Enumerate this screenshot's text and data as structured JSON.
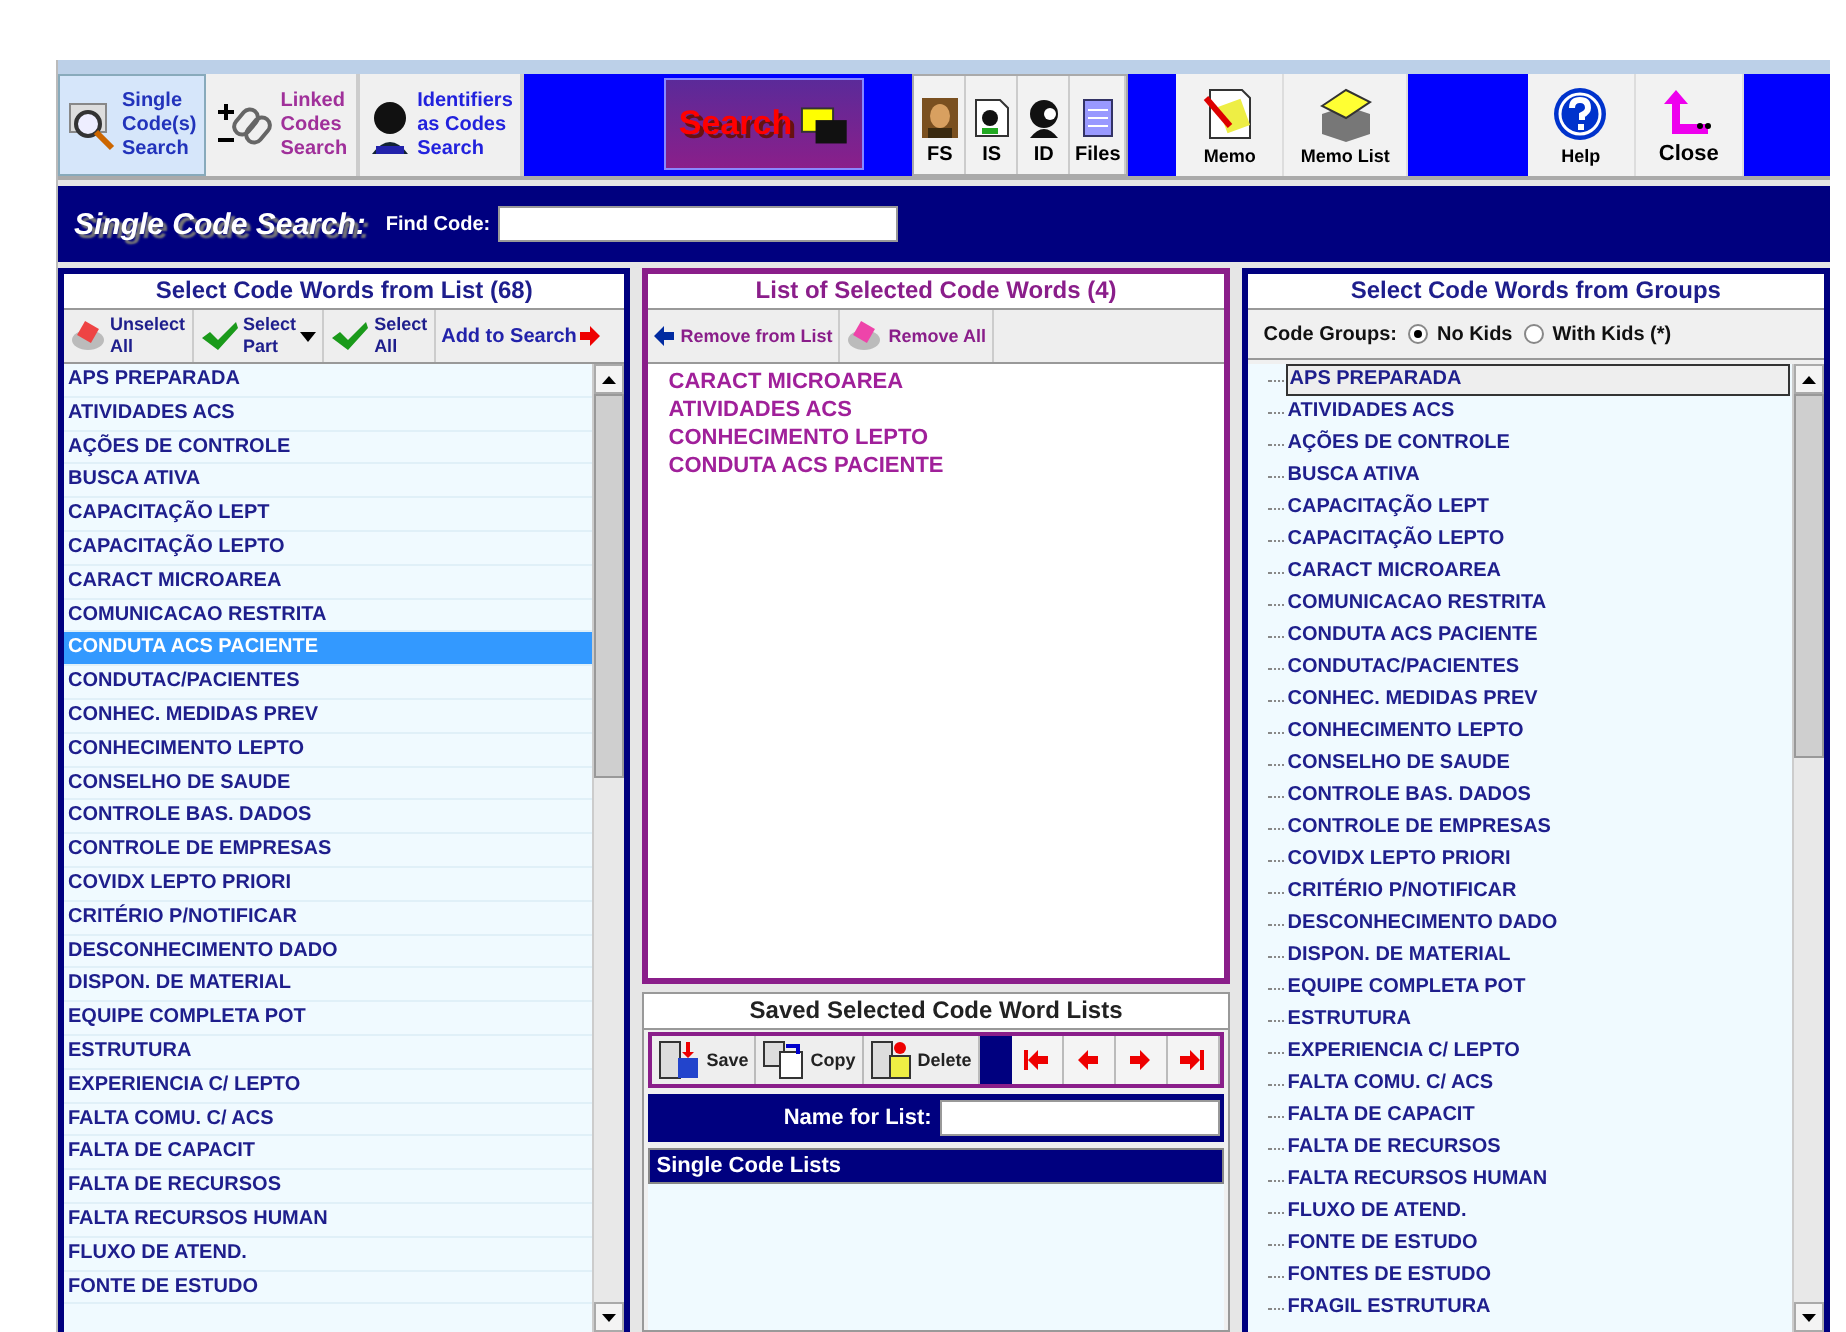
{
  "toolbar": {
    "mode_tabs": [
      {
        "kind": "single",
        "label_lines": [
          "Single",
          "Code(s)",
          "Search"
        ],
        "selected": true
      },
      {
        "kind": "linked",
        "label_lines": [
          "Linked",
          "Codes",
          "Search"
        ],
        "selected": false
      },
      {
        "kind": "identifiers",
        "label_lines": [
          "Identifiers",
          "as Codes",
          "Search"
        ],
        "selected": false
      }
    ],
    "search_button": {
      "label": "Search"
    },
    "small_buttons": [
      {
        "kind": "fs",
        "label": "FS"
      },
      {
        "kind": "is",
        "label": "IS"
      },
      {
        "kind": "id",
        "label": "ID"
      },
      {
        "kind": "files",
        "label": "Files"
      }
    ],
    "memo_buttons": [
      {
        "kind": "memo",
        "label": "Memo"
      },
      {
        "kind": "memo_list",
        "label": "Memo List"
      }
    ],
    "end_buttons": [
      {
        "kind": "help",
        "label": "Help"
      },
      {
        "kind": "close",
        "label": "Close"
      }
    ]
  },
  "search_header": {
    "title": "Single Code Search:",
    "find_label": "Find Code:"
  },
  "left_panel": {
    "title": "Select Code Words from List (68)",
    "tools": [
      {
        "kind": "unselect",
        "label_lines": [
          "Unselect",
          "All"
        ]
      },
      {
        "kind": "select_part",
        "label_lines": [
          "Select",
          "Part"
        ]
      },
      {
        "kind": "select_all",
        "label_lines": [
          "Select",
          "All"
        ]
      },
      {
        "kind": "add",
        "label_lines": [
          "Add to Search"
        ]
      }
    ],
    "items": [
      {
        "label": "APS PREPARADA",
        "selected": false
      },
      {
        "label": "ATIVIDADES ACS",
        "selected": false
      },
      {
        "label": "AÇÕES DE CONTROLE",
        "selected": false
      },
      {
        "label": "BUSCA ATIVA",
        "selected": false
      },
      {
        "label": "CAPACITAÇÃO LEPT",
        "selected": false
      },
      {
        "label": "CAPACITAÇÃO LEPTO",
        "selected": false
      },
      {
        "label": "CARACT MICROAREA",
        "selected": false
      },
      {
        "label": "COMUNICACAO RESTRITA",
        "selected": false
      },
      {
        "label": "CONDUTA ACS PACIENTE",
        "selected": true
      },
      {
        "label": "CONDUTAC/PACIENTES",
        "selected": false
      },
      {
        "label": "CONHEC. MEDIDAS PREV",
        "selected": false
      },
      {
        "label": "CONHECIMENTO LEPTO",
        "selected": false
      },
      {
        "label": "CONSELHO DE SAUDE",
        "selected": false
      },
      {
        "label": "CONTROLE BAS. DADOS",
        "selected": false
      },
      {
        "label": "CONTROLE DE EMPRESAS",
        "selected": false
      },
      {
        "label": "COVIDX LEPTO PRIORI",
        "selected": false
      },
      {
        "label": "CRITÉRIO P/NOTIFICAR",
        "selected": false
      },
      {
        "label": "DESCONHECIMENTO DADO",
        "selected": false
      },
      {
        "label": "DISPON. DE MATERIAL",
        "selected": false
      },
      {
        "label": "EQUIPE COMPLETA POT",
        "selected": false
      },
      {
        "label": "ESTRUTURA",
        "selected": false
      },
      {
        "label": "EXPERIENCIA C/ LEPTO",
        "selected": false
      },
      {
        "label": "FALTA COMU. C/ ACS",
        "selected": false
      },
      {
        "label": "FALTA DE CAPACIT",
        "selected": false
      },
      {
        "label": "FALTA DE RECURSOS",
        "selected": false
      },
      {
        "label": "FALTA RECURSOS HUMAN",
        "selected": false
      },
      {
        "label": "FLUXO DE ATEND.",
        "selected": false
      },
      {
        "label": "FONTE DE ESTUDO",
        "selected": false
      }
    ]
  },
  "middle_panel": {
    "title": "List of Selected Code Words (4)",
    "tools": [
      {
        "kind": "remove",
        "label": "Remove from List"
      },
      {
        "kind": "remove_all",
        "label": "Remove All"
      }
    ],
    "items": [
      "CARACT MICROAREA",
      "ATIVIDADES ACS",
      "CONHECIMENTO LEPTO",
      "CONDUTA ACS PACIENTE"
    ]
  },
  "saved_panel": {
    "title": "Saved Selected Code Word Lists",
    "tools": [
      {
        "kind": "save",
        "label": "Save"
      },
      {
        "kind": "copy",
        "label": "Copy"
      },
      {
        "kind": "delete",
        "label": "Delete"
      }
    ],
    "nav": [
      {
        "kind": "first"
      },
      {
        "kind": "prev"
      },
      {
        "kind": "next"
      },
      {
        "kind": "last"
      }
    ],
    "name_label": "Name for List:",
    "list_header": "Single Code Lists"
  },
  "right_panel": {
    "title": "Select Code Words from Groups",
    "groups_label": "Code Groups:",
    "options": [
      {
        "label": "No Kids",
        "selected": true
      },
      {
        "label": "With Kids (*)",
        "selected": false
      }
    ],
    "items": [
      {
        "label": "APS PREPARADA",
        "selected": true
      },
      {
        "label": "ATIVIDADES ACS",
        "selected": false
      },
      {
        "label": "AÇÕES DE CONTROLE",
        "selected": false
      },
      {
        "label": "BUSCA ATIVA",
        "selected": false
      },
      {
        "label": "CAPACITAÇÃO LEPT",
        "selected": false
      },
      {
        "label": "CAPACITAÇÃO LEPTO",
        "selected": false
      },
      {
        "label": "CARACT MICROAREA",
        "selected": false
      },
      {
        "label": "COMUNICACAO RESTRITA",
        "selected": false
      },
      {
        "label": "CONDUTA ACS PACIENTE",
        "selected": false
      },
      {
        "label": "CONDUTAC/PACIENTES",
        "selected": false
      },
      {
        "label": "CONHEC. MEDIDAS PREV",
        "selected": false
      },
      {
        "label": "CONHECIMENTO LEPTO",
        "selected": false
      },
      {
        "label": "CONSELHO DE SAUDE",
        "selected": false
      },
      {
        "label": "CONTROLE BAS. DADOS",
        "selected": false
      },
      {
        "label": "CONTROLE DE EMPRESAS",
        "selected": false
      },
      {
        "label": "COVIDX LEPTO PRIORI",
        "selected": false
      },
      {
        "label": "CRITÉRIO P/NOTIFICAR",
        "selected": false
      },
      {
        "label": "DESCONHECIMENTO DADO",
        "selected": false
      },
      {
        "label": "DISPON. DE MATERIAL",
        "selected": false
      },
      {
        "label": "EQUIPE COMPLETA POT",
        "selected": false
      },
      {
        "label": "ESTRUTURA",
        "selected": false
      },
      {
        "label": "EXPERIENCIA C/ LEPTO",
        "selected": false
      },
      {
        "label": "FALTA COMU. C/ ACS",
        "selected": false
      },
      {
        "label": "FALTA DE CAPACIT",
        "selected": false
      },
      {
        "label": "FALTA DE RECURSOS",
        "selected": false
      },
      {
        "label": "FALTA RECURSOS HUMAN",
        "selected": false
      },
      {
        "label": "FLUXO DE ATEND.",
        "selected": false
      },
      {
        "label": "FONTE DE ESTUDO",
        "selected": false
      },
      {
        "label": "FONTES DE ESTUDO",
        "selected": false
      },
      {
        "label": "FRAGIL ESTRUTURA",
        "selected": false
      }
    ]
  }
}
